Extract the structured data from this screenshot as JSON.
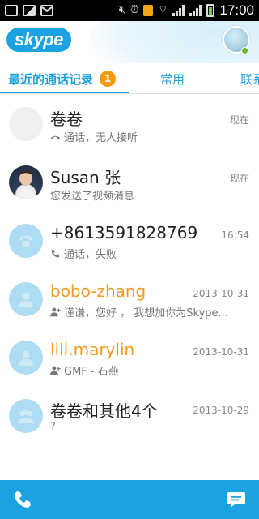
{
  "status_bar": {
    "time": "17:00"
  },
  "header": {
    "logo": "skype"
  },
  "tabs": [
    {
      "label": "最近的通话记录",
      "badge": "1"
    },
    {
      "label": "常用"
    },
    {
      "label": "联系人"
    }
  ],
  "conversations": [
    {
      "name": "卷卷",
      "time": "现在",
      "sub": "通话，无人接听",
      "avatar": "blank"
    },
    {
      "name": "Susan 张",
      "time": "现在",
      "sub": "您发送了视频消息",
      "avatar": "photo"
    },
    {
      "name": "+8613591828769",
      "time": "16:54",
      "sub": "通话，失败",
      "avatar": "phone"
    },
    {
      "name": "bobo-zhang",
      "time": "2013-10-31",
      "sub": "谨谦，您好 ， 我想加你为Skype...",
      "avatar": "person"
    },
    {
      "name": "lili.marylin",
      "time": "2013-10-31",
      "sub": "GMF - 石燕",
      "avatar": "person"
    },
    {
      "name": "卷卷和其他4个",
      "time": "2013-10-29",
      "sub": "?",
      "avatar": "group"
    }
  ]
}
